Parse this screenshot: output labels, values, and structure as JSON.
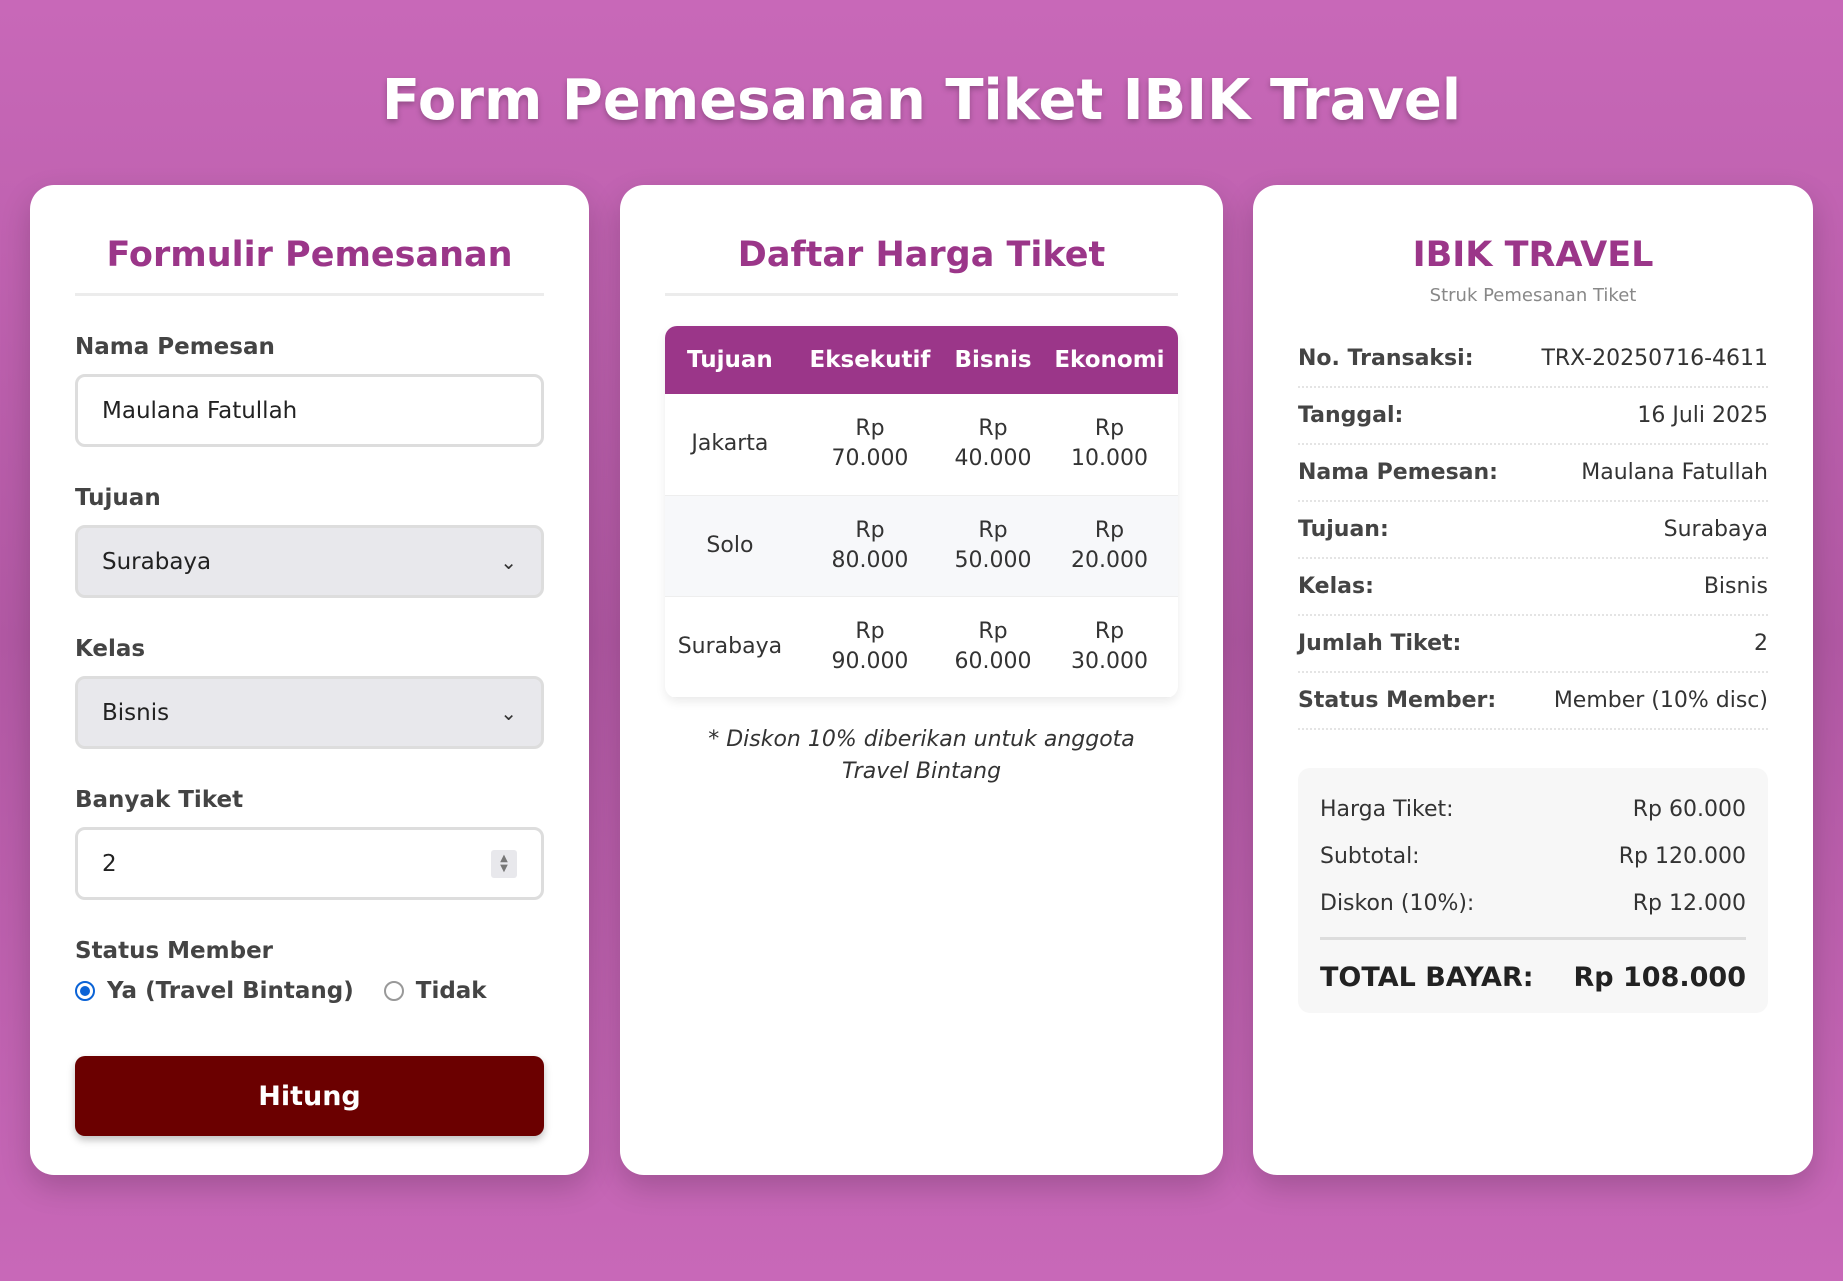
{
  "page": {
    "title": "Form Pemesanan Tiket IBIK Travel"
  },
  "form": {
    "title": "Formulir Pemesanan",
    "nama_label": "Nama Pemesan",
    "nama_value": "Maulana Fatullah",
    "tujuan_label": "Tujuan",
    "tujuan_value": "Surabaya",
    "kelas_label": "Kelas",
    "kelas_value": "Bisnis",
    "tiket_label": "Banyak Tiket",
    "tiket_value": "2",
    "member_label": "Status Member",
    "member_options": [
      "Ya (Travel Bintang)",
      "Tidak"
    ],
    "member_selected": "Ya (Travel Bintang)",
    "submit_label": "Hitung"
  },
  "prices": {
    "title": "Daftar Harga Tiket",
    "headers": [
      "Tujuan",
      "Eksekutif",
      "Bisnis",
      "Ekonomi"
    ],
    "rows": [
      {
        "tujuan": "Jakarta",
        "eksekutif": [
          "Rp",
          "70.000"
        ],
        "bisnis": [
          "Rp",
          "40.000"
        ],
        "ekonomi": [
          "Rp",
          "10.000"
        ]
      },
      {
        "tujuan": "Solo",
        "eksekutif": [
          "Rp",
          "80.000"
        ],
        "bisnis": [
          "Rp",
          "50.000"
        ],
        "ekonomi": [
          "Rp",
          "20.000"
        ]
      },
      {
        "tujuan": "Surabaya",
        "eksekutif": [
          "Rp",
          "90.000"
        ],
        "bisnis": [
          "Rp",
          "60.000"
        ],
        "ekonomi": [
          "Rp",
          "30.000"
        ]
      }
    ],
    "note": "* Diskon 10% diberikan untuk anggota Travel Bintang"
  },
  "receipt": {
    "title": "IBIK TRAVEL",
    "subtitle": "Struk Pemesanan Tiket",
    "rows": [
      {
        "label": "No. Transaksi:",
        "value": "TRX-20250716-4611"
      },
      {
        "label": "Tanggal:",
        "value": "16 Juli 2025"
      },
      {
        "label": "Nama Pemesan:",
        "value": "Maulana Fatullah"
      },
      {
        "label": "Tujuan:",
        "value": "Surabaya"
      },
      {
        "label": "Kelas:",
        "value": "Bisnis"
      },
      {
        "label": "Jumlah Tiket:",
        "value": "2"
      },
      {
        "label": "Status Member:",
        "value": "Member (10% disc)"
      }
    ],
    "summary": {
      "harga_label": "Harga Tiket:",
      "harga_value": "Rp 60.000",
      "subtotal_label": "Subtotal:",
      "subtotal_value": "Rp 120.000",
      "diskon_label": "Diskon (10%):",
      "diskon_value": "Rp 12.000",
      "total_label": "TOTAL BAYAR:",
      "total_value": "Rp 108.000"
    }
  },
  "colors": {
    "accent": "#9b3689",
    "button": "#6b0000",
    "background": "#c868b8",
    "radio": "#0b63d6"
  }
}
